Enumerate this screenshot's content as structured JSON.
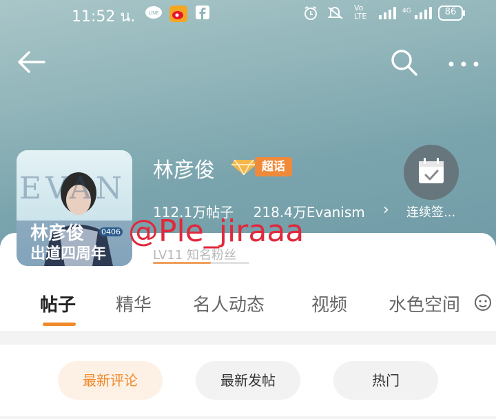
{
  "status_bar": {
    "time": "11:52 น.",
    "battery": "86"
  },
  "header": {
    "back_icon": "arrow-left-icon",
    "search_icon": "search-icon",
    "more_icon": "more-icon"
  },
  "profile": {
    "name": "林彦俊",
    "badge_label": "超话",
    "posts_stat": "112.1万帖子",
    "fans_stat": "218.4万Evanism",
    "checkin_label": "连续签...",
    "level_text": "LV11 知名粉丝",
    "level_progress": 0.6,
    "avatar_text_line1": "林彦俊",
    "avatar_text_line2": "出道四周年",
    "avatar_small_text": "0406",
    "avatar_big_letters": "EVAN"
  },
  "watermark": "@Ple_jiraaa",
  "tabs": [
    {
      "label": "帖子"
    },
    {
      "label": "精华"
    },
    {
      "label": "名人动态"
    },
    {
      "label": "视频"
    },
    {
      "label": "水色空间"
    }
  ],
  "filters": [
    {
      "label": "最新评论"
    },
    {
      "label": "最新发帖"
    },
    {
      "label": "热门"
    }
  ],
  "colors": {
    "accent": "#f08a2a",
    "watermark": "#e0283c"
  }
}
